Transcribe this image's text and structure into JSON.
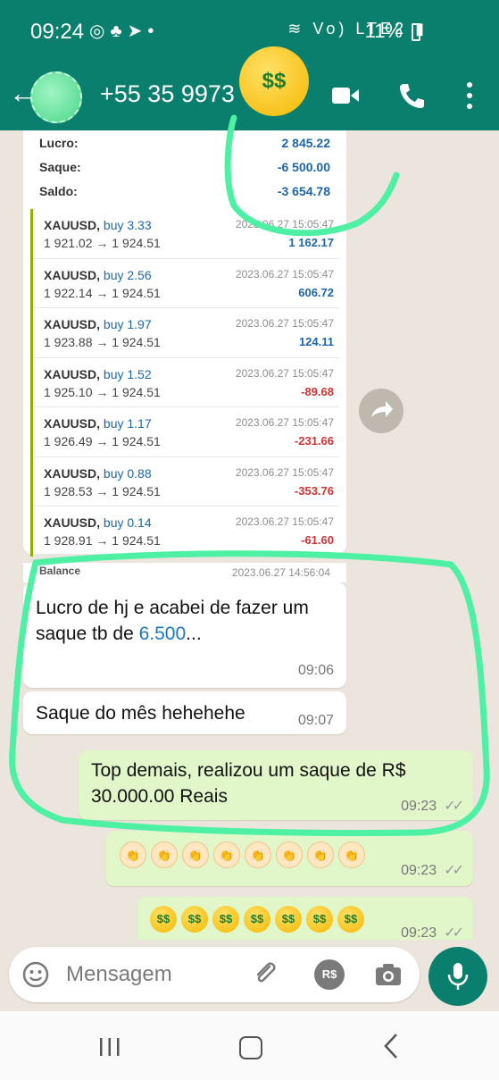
{
  "status_bar": {
    "time": "09:24",
    "left_icons": [
      "whatsapp-icon",
      "app-icon",
      "telegram-icon",
      "dot"
    ],
    "right_text": "Vo) LTE2",
    "battery": "11%"
  },
  "header": {
    "contact_name": "+55 35 9973",
    "emoji": "$$"
  },
  "card": {
    "summary": [
      {
        "label": "Lucro:",
        "value": "2 845.22"
      },
      {
        "label": "Saque:",
        "value": "-6 500.00"
      },
      {
        "label": "Saldo:",
        "value": "-3 654.78"
      }
    ],
    "trades": [
      {
        "symbol": "XAUUSD,",
        "side": "buy 3.33",
        "price": "1 921.02 → 1 924.51",
        "date": "2023.06.27 15:05:47",
        "profit": "1 162.17",
        "color": "#1d66a8"
      },
      {
        "symbol": "XAUUSD,",
        "side": "buy 2.56",
        "price": "1 922.14 → 1 924.51",
        "date": "2023.06.27 15:05:47",
        "profit": "606.72",
        "color": "#1d66a8"
      },
      {
        "symbol": "XAUUSD,",
        "side": "buy 1.97",
        "price": "1 923.88 → 1 924.51",
        "date": "2023.06.27 15:05:47",
        "profit": "124.11",
        "color": "#1d66a8"
      },
      {
        "symbol": "XAUUSD,",
        "side": "buy 1.52",
        "price": "1 925.10 → 1 924.51",
        "date": "2023.06.27 15:05:47",
        "profit": "-89.68",
        "color": "#d23333"
      },
      {
        "symbol": "XAUUSD,",
        "side": "buy 1.17",
        "price": "1 926.49 → 1 924.51",
        "date": "2023.06.27 15:05:47",
        "profit": "-231.66",
        "color": "#d23333"
      },
      {
        "symbol": "XAUUSD,",
        "side": "buy 0.88",
        "price": "1 928.53 → 1 924.51",
        "date": "2023.06.27 15:05:47",
        "profit": "-353.76",
        "color": "#d23333"
      },
      {
        "symbol": "XAUUSD,",
        "side": "buy 0.14",
        "price": "1 928.91 → 1 924.51",
        "date": "2023.06.27 15:05:47",
        "profit": "-61.60",
        "color": "#d23333"
      }
    ],
    "balance_label": "Balance",
    "balance_date": "2023.06.27 14:56:04"
  },
  "messages": {
    "m1_text_a": "Lucro de hj e acabei de fazer um saque tb de ",
    "m1_link": "6.500",
    "m1_text_b": "...",
    "m1_time": "09:06",
    "m2_text": "Saque do mês hehehehe",
    "m2_time": "09:07",
    "m3_text": "Top demais, realizou um saque de R$ 30.000.00 Reais",
    "m3_time": "09:23",
    "m4_time": "09:23",
    "m5_time": "09:23",
    "ticks": "✓✓"
  },
  "input": {
    "placeholder": "Mensagem",
    "rs_label": "R$"
  },
  "colors": {
    "header": "#0b7f6e",
    "outgoing": "#e1f7c9",
    "highlight": "#4ef0a3"
  }
}
